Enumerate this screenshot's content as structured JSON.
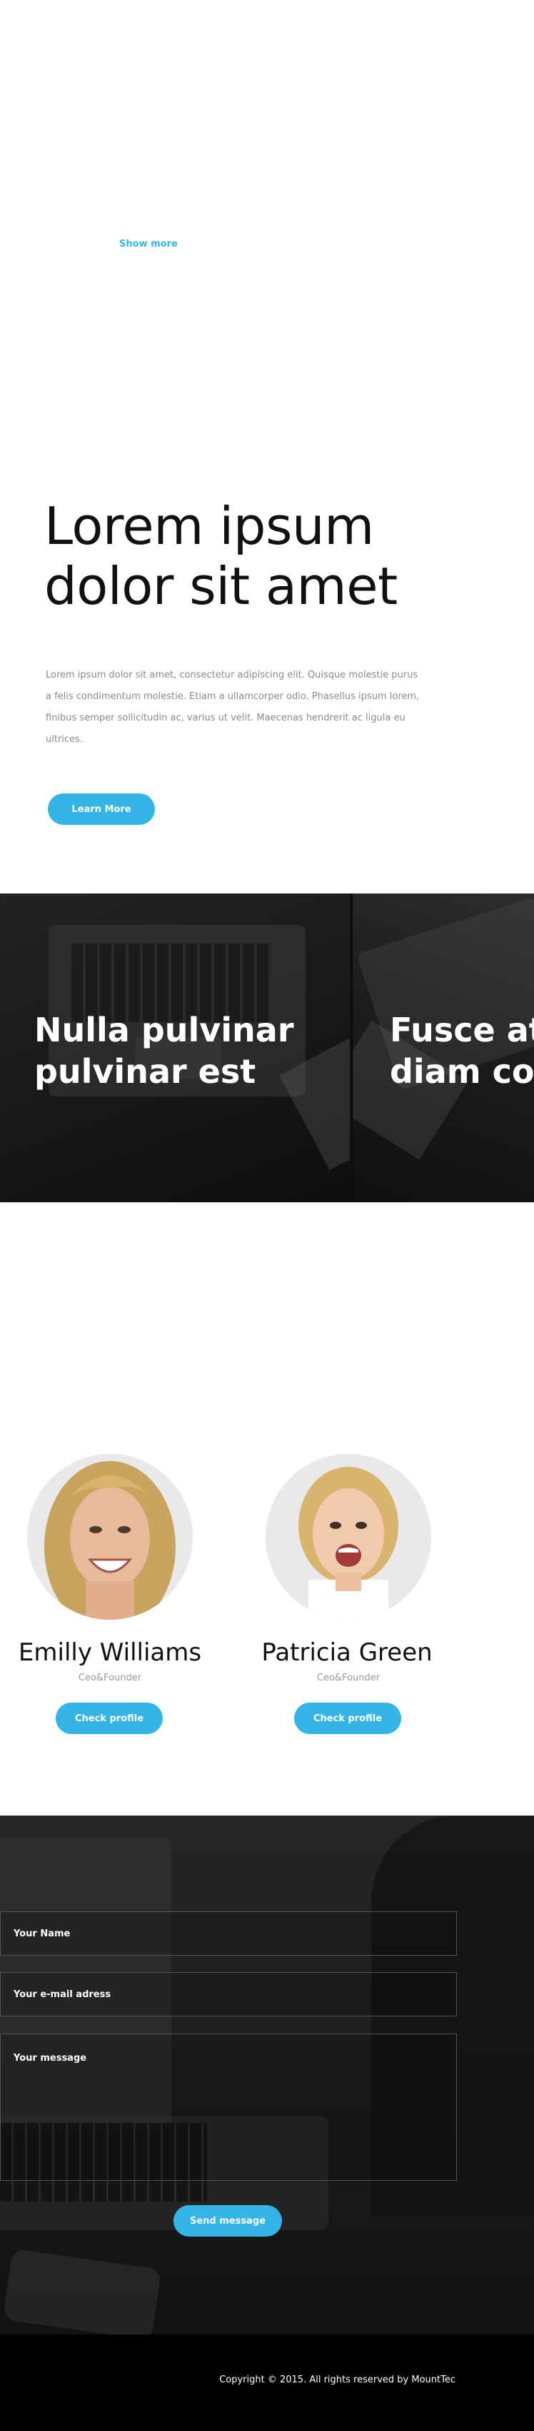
{
  "intro": {
    "show_more_label": "Show more"
  },
  "hero": {
    "title_line1": "Lorem ipsum",
    "title_line2": "dolor sit amet",
    "body": "Lorem ipsum dolor sit amet, consectetur adipiscing elit. Quisque molestie purus a felis condimentum molestie. Etiam a ullamcorper odio. Phasellus ipsum lorem, finibus semper sollicitudin ac, varius ut velit. Maecenas hendrerit ac ligula eu ultrices.",
    "button_label": "Learn More"
  },
  "features": [
    {
      "title_line1": "Nulla pulvinar",
      "title_line2": "pulvinar est"
    },
    {
      "title_line1": "Fusce at",
      "title_line2": "diam cor"
    }
  ],
  "team": [
    {
      "name": "Emilly Williams",
      "role": "Ceo&Founder",
      "button_label": "Check profile"
    },
    {
      "name": "Patricia Green",
      "role": "Ceo&Founder",
      "button_label": "Check profile"
    }
  ],
  "contact": {
    "name_placeholder": "Your Name",
    "email_placeholder": "Your e-mail adress",
    "message_placeholder": "Your message",
    "send_label": "Send message"
  },
  "footer": {
    "copyright": "Copyright © 2015. All rights reserved by MountTec"
  },
  "colors": {
    "accent": "#33b5e8",
    "dark": "#121212",
    "footer": "#000000"
  }
}
